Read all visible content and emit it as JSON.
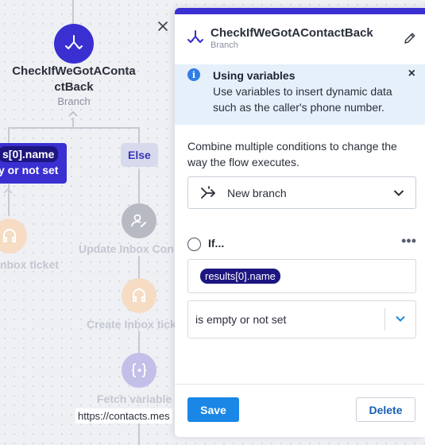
{
  "canvas": {
    "branch_node": {
      "title_line1": "CheckIfWeGotAConta",
      "title_line2": "ctBack",
      "type": "Branch"
    },
    "condition_box": {
      "variable": "s[0].name",
      "operator": "y or not set"
    },
    "else_label": "Else",
    "left_node_label": "nbox ticket",
    "update_node_label": "Update Inbox Con",
    "create_node_label": "Create Inbox tick",
    "fetch_node_label": "Fetch variable",
    "url_text": "https://contacts.mes",
    "colors": {
      "branch_node": "#3a2fd1",
      "faded_node": "#f5d9c0",
      "update_node": "#b7bac3",
      "fetch_node": "#c2bfe8"
    }
  },
  "panel": {
    "title": "CheckIfWeGotAContactBack",
    "subtitle": "Branch",
    "info": {
      "title": "Using variables",
      "text": "Use variables to insert dynamic data such as the caller's phone number.",
      "close": "×"
    },
    "description": "Combine multiple conditions to change the way the flow executes.",
    "branch_select": {
      "value": "New branch"
    },
    "condition": {
      "label": "If...",
      "more": "•••",
      "variable_chip": "results[0].name",
      "operator_value": "is empty or not set"
    },
    "footer": {
      "save_label": "Save",
      "delete_label": "Delete"
    },
    "accent": "#3a2fd1"
  }
}
